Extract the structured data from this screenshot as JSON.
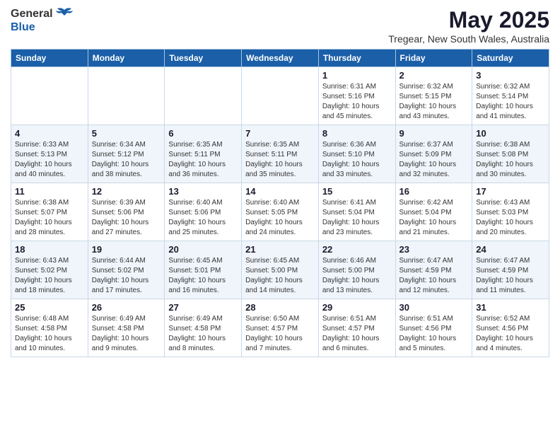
{
  "logo": {
    "general": "General",
    "blue": "Blue"
  },
  "title": "May 2025",
  "subtitle": "Tregear, New South Wales, Australia",
  "weekdays": [
    "Sunday",
    "Monday",
    "Tuesday",
    "Wednesday",
    "Thursday",
    "Friday",
    "Saturday"
  ],
  "weeks": [
    [
      {
        "day": "",
        "info": ""
      },
      {
        "day": "",
        "info": ""
      },
      {
        "day": "",
        "info": ""
      },
      {
        "day": "",
        "info": ""
      },
      {
        "day": "1",
        "info": "Sunrise: 6:31 AM\nSunset: 5:16 PM\nDaylight: 10 hours\nand 45 minutes."
      },
      {
        "day": "2",
        "info": "Sunrise: 6:32 AM\nSunset: 5:15 PM\nDaylight: 10 hours\nand 43 minutes."
      },
      {
        "day": "3",
        "info": "Sunrise: 6:32 AM\nSunset: 5:14 PM\nDaylight: 10 hours\nand 41 minutes."
      }
    ],
    [
      {
        "day": "4",
        "info": "Sunrise: 6:33 AM\nSunset: 5:13 PM\nDaylight: 10 hours\nand 40 minutes."
      },
      {
        "day": "5",
        "info": "Sunrise: 6:34 AM\nSunset: 5:12 PM\nDaylight: 10 hours\nand 38 minutes."
      },
      {
        "day": "6",
        "info": "Sunrise: 6:35 AM\nSunset: 5:11 PM\nDaylight: 10 hours\nand 36 minutes."
      },
      {
        "day": "7",
        "info": "Sunrise: 6:35 AM\nSunset: 5:11 PM\nDaylight: 10 hours\nand 35 minutes."
      },
      {
        "day": "8",
        "info": "Sunrise: 6:36 AM\nSunset: 5:10 PM\nDaylight: 10 hours\nand 33 minutes."
      },
      {
        "day": "9",
        "info": "Sunrise: 6:37 AM\nSunset: 5:09 PM\nDaylight: 10 hours\nand 32 minutes."
      },
      {
        "day": "10",
        "info": "Sunrise: 6:38 AM\nSunset: 5:08 PM\nDaylight: 10 hours\nand 30 minutes."
      }
    ],
    [
      {
        "day": "11",
        "info": "Sunrise: 6:38 AM\nSunset: 5:07 PM\nDaylight: 10 hours\nand 28 minutes."
      },
      {
        "day": "12",
        "info": "Sunrise: 6:39 AM\nSunset: 5:06 PM\nDaylight: 10 hours\nand 27 minutes."
      },
      {
        "day": "13",
        "info": "Sunrise: 6:40 AM\nSunset: 5:06 PM\nDaylight: 10 hours\nand 25 minutes."
      },
      {
        "day": "14",
        "info": "Sunrise: 6:40 AM\nSunset: 5:05 PM\nDaylight: 10 hours\nand 24 minutes."
      },
      {
        "day": "15",
        "info": "Sunrise: 6:41 AM\nSunset: 5:04 PM\nDaylight: 10 hours\nand 23 minutes."
      },
      {
        "day": "16",
        "info": "Sunrise: 6:42 AM\nSunset: 5:04 PM\nDaylight: 10 hours\nand 21 minutes."
      },
      {
        "day": "17",
        "info": "Sunrise: 6:43 AM\nSunset: 5:03 PM\nDaylight: 10 hours\nand 20 minutes."
      }
    ],
    [
      {
        "day": "18",
        "info": "Sunrise: 6:43 AM\nSunset: 5:02 PM\nDaylight: 10 hours\nand 18 minutes."
      },
      {
        "day": "19",
        "info": "Sunrise: 6:44 AM\nSunset: 5:02 PM\nDaylight: 10 hours\nand 17 minutes."
      },
      {
        "day": "20",
        "info": "Sunrise: 6:45 AM\nSunset: 5:01 PM\nDaylight: 10 hours\nand 16 minutes."
      },
      {
        "day": "21",
        "info": "Sunrise: 6:45 AM\nSunset: 5:00 PM\nDaylight: 10 hours\nand 14 minutes."
      },
      {
        "day": "22",
        "info": "Sunrise: 6:46 AM\nSunset: 5:00 PM\nDaylight: 10 hours\nand 13 minutes."
      },
      {
        "day": "23",
        "info": "Sunrise: 6:47 AM\nSunset: 4:59 PM\nDaylight: 10 hours\nand 12 minutes."
      },
      {
        "day": "24",
        "info": "Sunrise: 6:47 AM\nSunset: 4:59 PM\nDaylight: 10 hours\nand 11 minutes."
      }
    ],
    [
      {
        "day": "25",
        "info": "Sunrise: 6:48 AM\nSunset: 4:58 PM\nDaylight: 10 hours\nand 10 minutes."
      },
      {
        "day": "26",
        "info": "Sunrise: 6:49 AM\nSunset: 4:58 PM\nDaylight: 10 hours\nand 9 minutes."
      },
      {
        "day": "27",
        "info": "Sunrise: 6:49 AM\nSunset: 4:58 PM\nDaylight: 10 hours\nand 8 minutes."
      },
      {
        "day": "28",
        "info": "Sunrise: 6:50 AM\nSunset: 4:57 PM\nDaylight: 10 hours\nand 7 minutes."
      },
      {
        "day": "29",
        "info": "Sunrise: 6:51 AM\nSunset: 4:57 PM\nDaylight: 10 hours\nand 6 minutes."
      },
      {
        "day": "30",
        "info": "Sunrise: 6:51 AM\nSunset: 4:56 PM\nDaylight: 10 hours\nand 5 minutes."
      },
      {
        "day": "31",
        "info": "Sunrise: 6:52 AM\nSunset: 4:56 PM\nDaylight: 10 hours\nand 4 minutes."
      }
    ]
  ]
}
